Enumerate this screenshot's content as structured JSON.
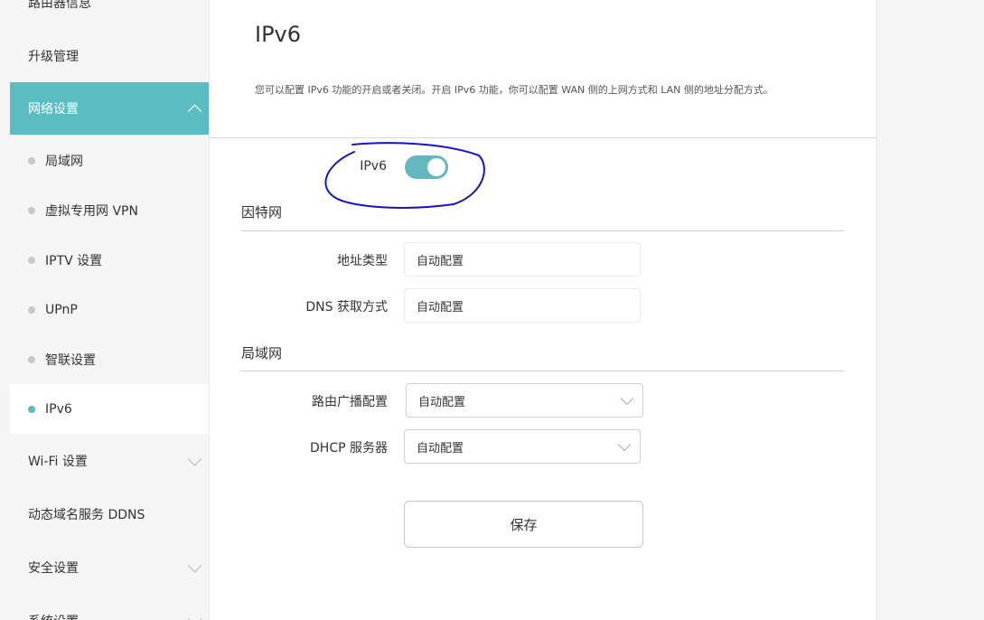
{
  "sidebar": {
    "items": [
      {
        "label": "路由器信息"
      },
      {
        "label": "升级管理"
      },
      {
        "label": "网络设置"
      },
      {
        "label": "Wi-Fi 设置"
      },
      {
        "label": "动态域名服务 DDNS"
      },
      {
        "label": "安全设置"
      },
      {
        "label": "系统设置"
      }
    ],
    "network_sub": [
      {
        "label": "局域网"
      },
      {
        "label": "虚拟专用网 VPN"
      },
      {
        "label": "IPTV 设置"
      },
      {
        "label": "UPnP"
      },
      {
        "label": "智联设置"
      },
      {
        "label": "IPv6"
      }
    ]
  },
  "main": {
    "title": "IPv6",
    "description": "您可以配置 IPv6 功能的开启或者关闭。开启 IPv6 功能，你可以配置 WAN 侧的上网方式和 LAN 侧的地址分配方式。",
    "toggle": {
      "label": "IPv6",
      "state": "on"
    },
    "internet": {
      "title": "因特网",
      "address_type_label": "地址类型",
      "address_type_value": "自动配置",
      "dns_label": "DNS 获取方式",
      "dns_value": "自动配置"
    },
    "lan": {
      "title": "局域网",
      "router_adv_label": "路由广播配置",
      "router_adv_value": "自动配置",
      "dhcp_label": "DHCP 服务器",
      "dhcp_value": "自动配置"
    },
    "save_label": "保存"
  },
  "colors": {
    "accent": "#5bbcc2",
    "annotation": "#1414c8"
  }
}
